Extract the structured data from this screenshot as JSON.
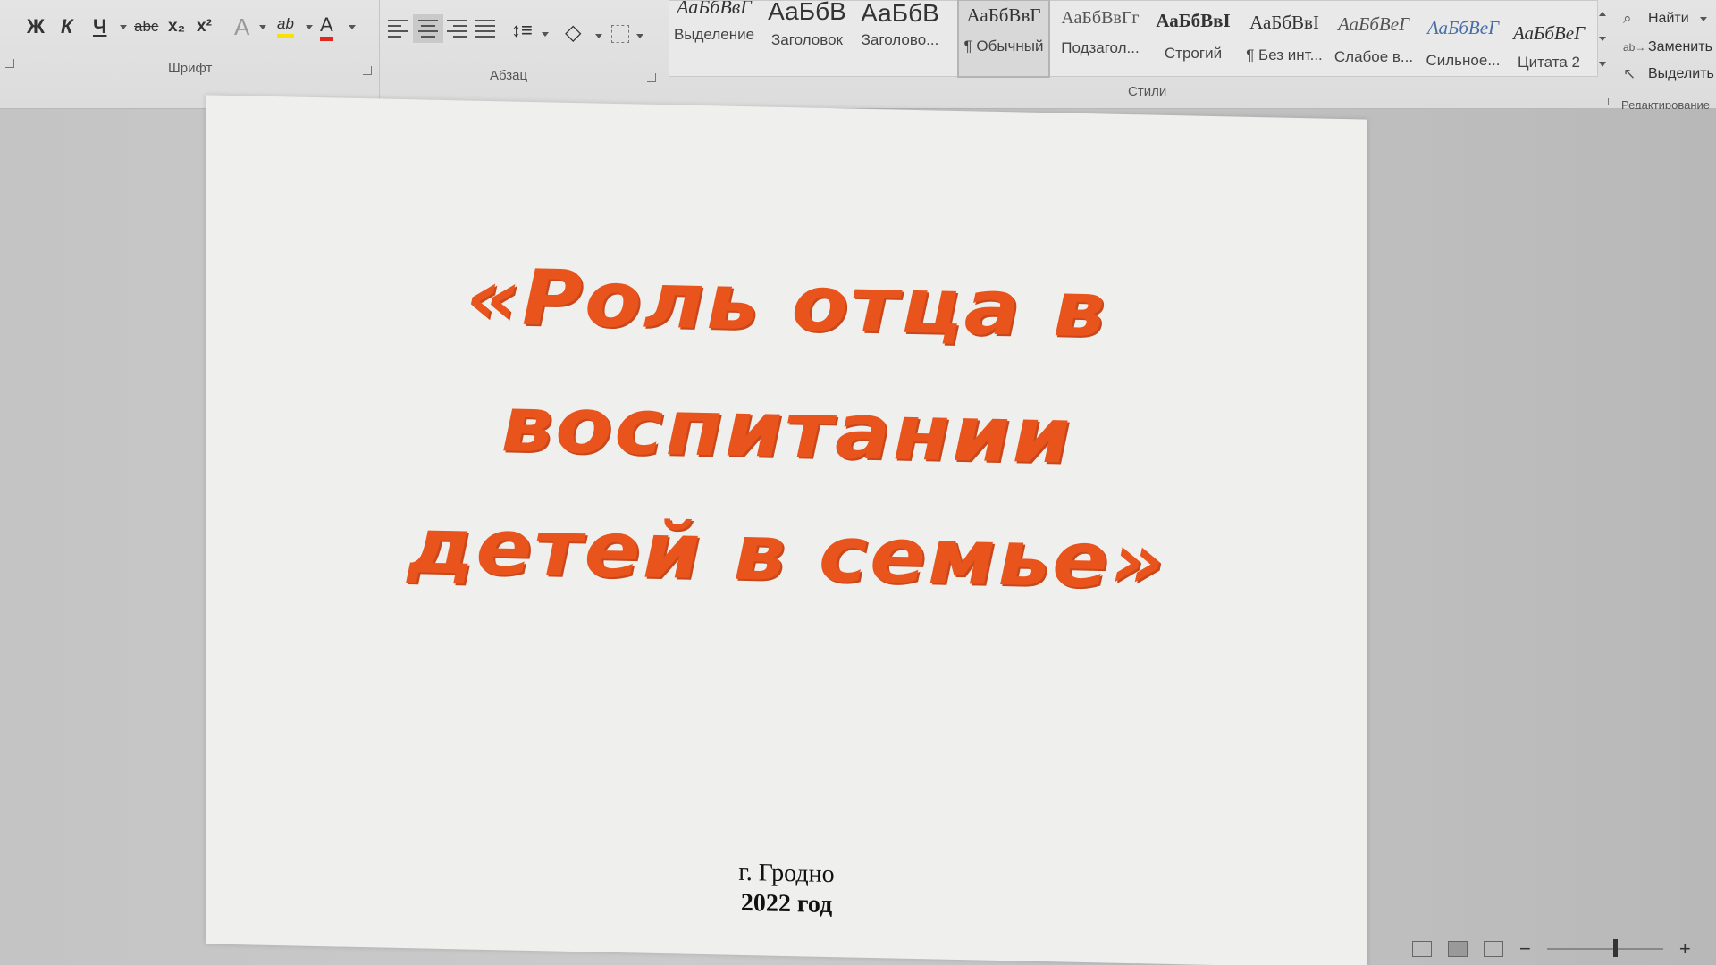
{
  "ribbon": {
    "font_group": {
      "label": "Шрифт",
      "bold": "Ж",
      "italic": "К",
      "underline": "Ч",
      "strikethrough": "abc",
      "subscript": "x₂",
      "superscript": "x²",
      "text_effects": "A",
      "highlight": "ab",
      "font_color": "A"
    },
    "paragraph_group": {
      "label": "Абзац"
    },
    "styles_group": {
      "label": "Стили",
      "styles": [
        {
          "preview": "АаБбВвГ",
          "name": "Выделение"
        },
        {
          "preview": "АаБбВ",
          "name": "Заголовок"
        },
        {
          "preview": "АаБбВ",
          "name": "Заголово..."
        },
        {
          "preview": "АаБбВвГ",
          "name": "¶ Обычный",
          "selected": true
        },
        {
          "preview": "АаБбВвГг",
          "name": "Подзагол..."
        },
        {
          "preview": "АаБбВвІ",
          "name": "Строгий"
        },
        {
          "preview": "АаБбВвІ",
          "name": "¶ Без инт..."
        },
        {
          "preview": "АаБбВеГ",
          "name": "Слабое в..."
        },
        {
          "preview": "АаБбВеГ",
          "name": "Сильное..."
        },
        {
          "preview": "АаБбВеГ",
          "name": "Цитата 2"
        }
      ]
    },
    "editing_group": {
      "label": "Редактирование",
      "find": "Найти",
      "replace": "Заменить",
      "select": "Выделить"
    },
    "colors": {
      "highlight": "#f5e400",
      "font_color": "#e0281e"
    }
  },
  "document": {
    "title_lines": [
      "«Роль отца в",
      "воспитании",
      "детей в семье»"
    ],
    "city": "г. Гродно",
    "year": "2022 год",
    "title_color": "#e8541c"
  },
  "statusbar": {
    "zoom_minus": "−",
    "zoom_plus": "+"
  }
}
